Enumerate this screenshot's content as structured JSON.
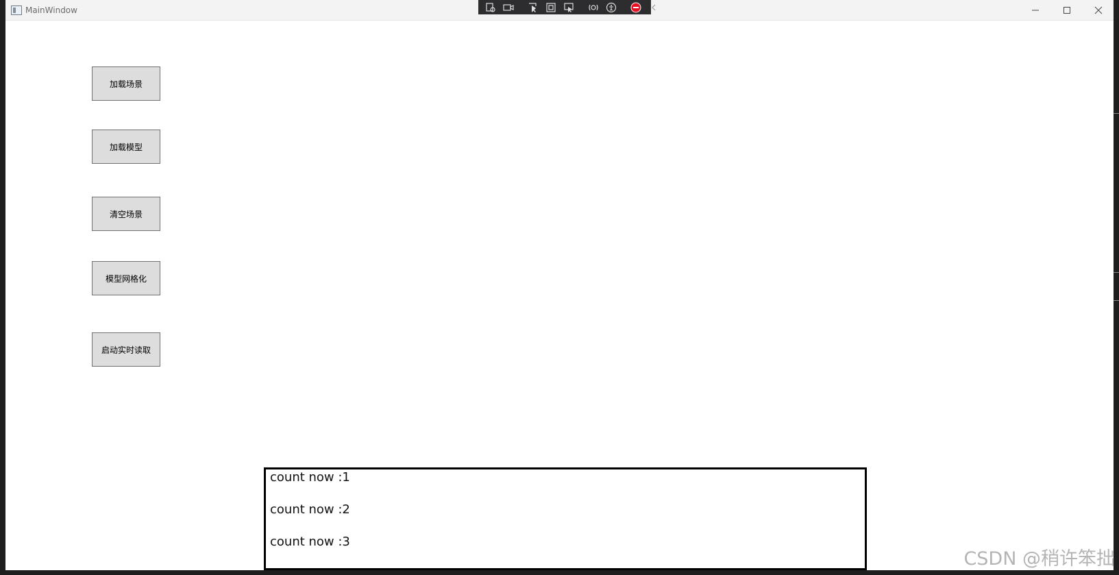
{
  "window": {
    "title": "MainWindow",
    "controls": {
      "minimize": "–",
      "maximize": "☐",
      "close": "✕"
    }
  },
  "debug_toolbar": {
    "icons": [
      "live-visual-tree-icon",
      "record-icon",
      "select-element-icon",
      "display-layout-adorners-icon",
      "track-focus-icon",
      "hot-reload-icon",
      "accessibility-icon",
      "binding-failures-icon",
      "collapse-icon"
    ]
  },
  "buttons": {
    "load_scene": "加载场景",
    "load_model": "加载模型",
    "clear_scene": "清空场景",
    "mesh_model": "模型网格化",
    "start_realtime": "启动实时读取"
  },
  "log": {
    "lines": [
      "count now :1",
      "count now :2",
      "count now :3"
    ]
  },
  "watermark": "CSDN @稍许笨拙",
  "colors": {
    "button_bg": "#dddddd",
    "button_border": "#707070",
    "titlebar_bg": "#f3f3f3",
    "toolbar_bg": "#2d2d30"
  }
}
